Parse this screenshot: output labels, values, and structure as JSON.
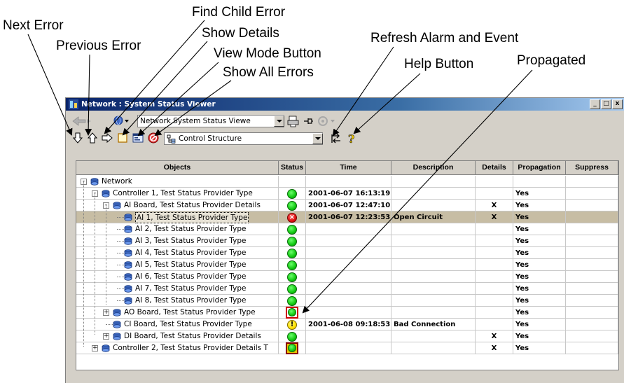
{
  "callouts": {
    "next_error": "Next Error",
    "previous_error": "Previous Error",
    "find_child_error": "Find Child Error",
    "show_details": "Show Details",
    "view_mode_button": "View Mode Button",
    "show_all_errors": "Show All Errors",
    "refresh_alarm_event": "Refresh Alarm and Event",
    "help_button": "Help Button",
    "propagated": "Propagated"
  },
  "window": {
    "title": "Network : System Status Viewer",
    "minimize": "_",
    "maximize": "□",
    "close": "x"
  },
  "toolbar1": {
    "path_combo": "Network System Status Viewe"
  },
  "toolbar2": {
    "structure_combo": "Control Structure"
  },
  "grid": {
    "columns": [
      "Objects",
      "Status",
      "Time",
      "Description",
      "Details",
      "Propagation",
      "Suppress"
    ],
    "rows": [
      {
        "object": "Network",
        "level": 0,
        "expander": "-",
        "status": "",
        "time": "",
        "description": "",
        "details": "",
        "propagation": "",
        "selected": false
      },
      {
        "object": "Controller 1, Test Status Provider Type",
        "level": 1,
        "expander": "-",
        "status": "ok",
        "time": "2001-06-07 16:13:19",
        "description": "",
        "details": "",
        "propagation": "Yes",
        "selected": false
      },
      {
        "object": "AI Board, Test Status Provider Details",
        "level": 2,
        "expander": "-",
        "status": "ok",
        "time": "2001-06-07 12:47:10",
        "description": "",
        "details": "X",
        "propagation": "Yes",
        "selected": false
      },
      {
        "object": "AI 1, Test Status Provider Type",
        "level": 3,
        "expander": "",
        "status": "error",
        "time": "2001-06-07 12:23:53",
        "description": "Open Circuit",
        "details": "X",
        "propagation": "Yes",
        "selected": true
      },
      {
        "object": "AI 2, Test Status Provider Type",
        "level": 3,
        "expander": "",
        "status": "ok",
        "time": "",
        "description": "",
        "details": "",
        "propagation": "Yes",
        "selected": false
      },
      {
        "object": "AI 3, Test Status Provider Type",
        "level": 3,
        "expander": "",
        "status": "ok",
        "time": "",
        "description": "",
        "details": "",
        "propagation": "Yes",
        "selected": false
      },
      {
        "object": "AI 4, Test Status Provider Type",
        "level": 3,
        "expander": "",
        "status": "ok",
        "time": "",
        "description": "",
        "details": "",
        "propagation": "Yes",
        "selected": false
      },
      {
        "object": "AI 5, Test Status Provider Type",
        "level": 3,
        "expander": "",
        "status": "ok",
        "time": "",
        "description": "",
        "details": "",
        "propagation": "Yes",
        "selected": false
      },
      {
        "object": "AI 6, Test Status Provider Type",
        "level": 3,
        "expander": "",
        "status": "ok",
        "time": "",
        "description": "",
        "details": "",
        "propagation": "Yes",
        "selected": false
      },
      {
        "object": "AI 7, Test Status Provider Type",
        "level": 3,
        "expander": "",
        "status": "ok",
        "time": "",
        "description": "",
        "details": "",
        "propagation": "Yes",
        "selected": false
      },
      {
        "object": "AI 8, Test Status Provider Type",
        "level": 3,
        "expander": "",
        "status": "ok",
        "time": "",
        "description": "",
        "details": "",
        "propagation": "Yes",
        "selected": false
      },
      {
        "object": "AO Board, Test Status Provider Type",
        "level": 2,
        "expander": "+",
        "status": "propagated",
        "time": "",
        "description": "",
        "details": "",
        "propagation": "Yes",
        "selected": false
      },
      {
        "object": "CI Board, Test Status Provider Type",
        "level": 2,
        "expander": "",
        "status": "warning",
        "time": "2001-06-08 09:18:53",
        "description": "Bad Connection",
        "details": "",
        "propagation": "Yes",
        "selected": false
      },
      {
        "object": "DI Board, Test Status Provider Details",
        "level": 2,
        "expander": "+",
        "status": "ok",
        "time": "",
        "description": "",
        "details": "X",
        "propagation": "Yes",
        "selected": false
      },
      {
        "object": "Controller 2, Test Status Provider Details T",
        "level": 1,
        "expander": "+",
        "status": "propagated-warn",
        "time": "",
        "description": "",
        "details": "X",
        "propagation": "Yes",
        "selected": false
      }
    ]
  },
  "icons": {
    "next_error": "arrow-down-icon",
    "previous_error": "arrow-up-icon",
    "find_child_error": "arrow-right-icon",
    "show_details": "details-box-icon",
    "view_mode": "view-mode-icon",
    "show_all_errors": "stop-error-icon",
    "refresh": "refresh-icon",
    "help": "help-icon"
  },
  "colors": {
    "title_bar": "#0a246a",
    "selected_row": "#c7bda4",
    "status_ok": "#11c911",
    "status_error": "#e01010",
    "status_warning": "#ffe100"
  }
}
